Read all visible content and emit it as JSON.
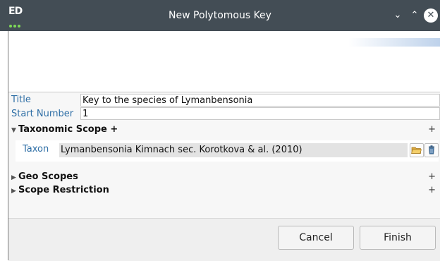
{
  "window": {
    "title": "New Polytomous Key",
    "app_logo_text": "ED",
    "controls": {
      "minimize": "⌄",
      "maximize": "⌃",
      "close": "✕"
    }
  },
  "form": {
    "title_label": "Title",
    "title_value": "Key to the species of Lymanbensonia",
    "start_number_label": "Start Number",
    "start_number_value": "1"
  },
  "taxonomic_scope": {
    "header": "Taxonomic Scope +",
    "expanded": true,
    "add": "+",
    "taxon_label": "Taxon",
    "taxon_value": "Lymanbensonia Kimnach sec. Korotkova & al. (2010)",
    "browse_icon": "folder-open-icon",
    "delete_icon": "trash-icon"
  },
  "geo_scopes": {
    "header": "Geo Scopes",
    "expanded": false,
    "add": "+"
  },
  "scope_restriction": {
    "header": "Scope Restriction",
    "expanded": false,
    "add": "+"
  },
  "buttons": {
    "cancel": "Cancel",
    "finish": "Finish"
  },
  "colors": {
    "titlebar": "#434d55",
    "label_blue": "#2f6fa6",
    "logo_green": "#7ed957",
    "folder_yellow": "#e8b84a",
    "trash_blue": "#3a5f86"
  }
}
